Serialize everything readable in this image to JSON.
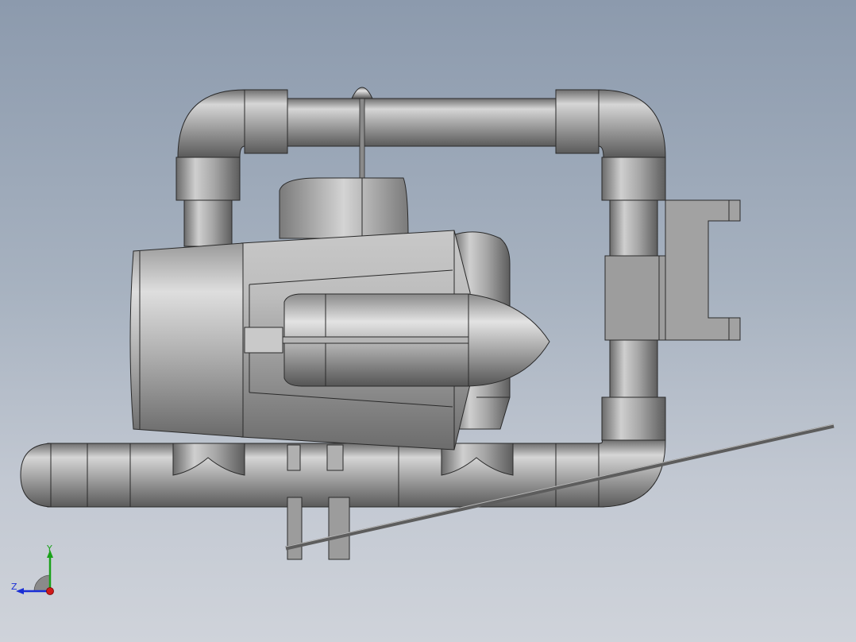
{
  "viewport": {
    "background_top": "#8c9aad",
    "background_bottom": "#cfd3da",
    "model_color": "#9a9a9a",
    "edge_color": "#2a2a2a"
  },
  "triad": {
    "y_label": "Y",
    "z_label": "Z",
    "y_color": "#1aa11a",
    "z_color": "#1a2fd6",
    "x_color": "#d01a1a"
  }
}
